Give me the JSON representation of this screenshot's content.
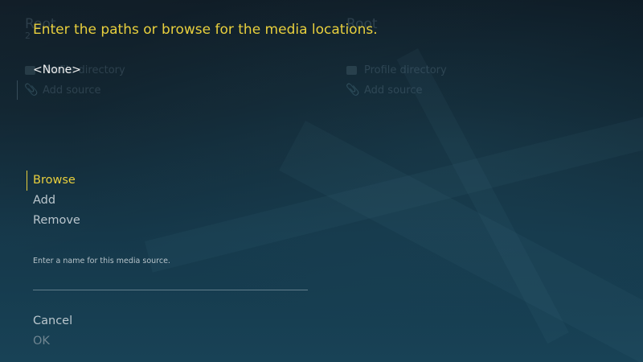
{
  "background_window": {
    "left_title": "Root",
    "left_subtitle": "2",
    "right_title": "Root",
    "left_items": [
      "Profile directory",
      "Add source"
    ],
    "right_items": [
      "Profile directory",
      "Add source"
    ]
  },
  "dialog": {
    "title": "Enter the paths or browse for the media locations.",
    "paths": [
      "<None>"
    ],
    "buttons": {
      "browse": "Browse",
      "add": "Add",
      "remove": "Remove"
    },
    "name_label": "Enter a name for this media source.",
    "name_value": "",
    "cancel": "Cancel",
    "ok": "OK"
  },
  "colors": {
    "accent": "#e8cf3d",
    "text": "#f2f2f2",
    "muted": "#bac6cd",
    "disabled": "#6f8591"
  }
}
